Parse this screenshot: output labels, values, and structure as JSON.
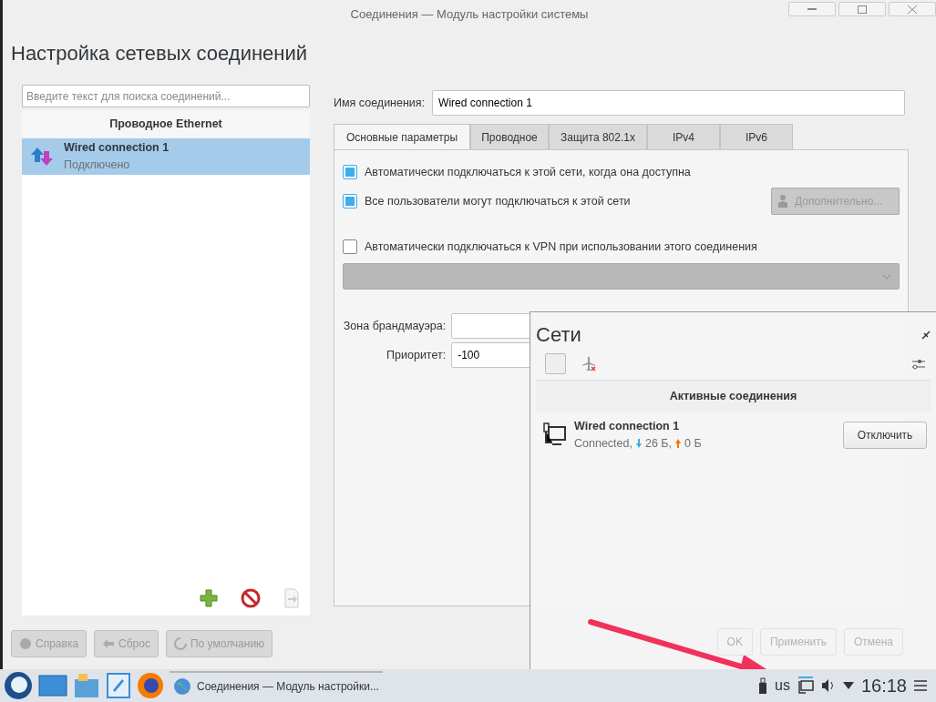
{
  "window": {
    "title": "Соединения — Модуль настройки системы",
    "heading": "Настройка сетевых соединений"
  },
  "connections": {
    "search_placeholder": "Введите текст для поиска соединений...",
    "group": "Проводное Ethernet",
    "items": [
      {
        "name": "Wired connection 1",
        "status": "Подключено",
        "selected": true
      }
    ]
  },
  "editor": {
    "name_label": "Имя соединения:",
    "name_value": "Wired connection 1",
    "tabs": [
      {
        "label": "Основные параметры",
        "selected": true
      },
      {
        "label": "Проводное",
        "selected": false
      },
      {
        "label": "Защита 802.1x",
        "selected": false
      },
      {
        "label": "IPv4",
        "selected": false
      },
      {
        "label": "IPv6",
        "selected": false
      }
    ],
    "options": [
      {
        "label": "Автоматически подключаться к этой сети, когда она доступна",
        "checked": true
      },
      {
        "label": "Все пользователи могут подключаться к этой сети",
        "checked": true
      },
      {
        "label": "Автоматически подключаться к VPN при использовании этого соединения",
        "checked": false
      }
    ],
    "advanced_button": {
      "label": "Дополнительно...",
      "disabled": true
    },
    "vpn_combo": {
      "disabled": true
    },
    "firewall_label": "Зона брандмауэра:",
    "priority_label": "Приоритет:",
    "priority_value": "-100"
  },
  "footer_buttons": [
    {
      "label": "Справка",
      "disabled": true
    },
    {
      "label": "Сброс",
      "disabled": true
    },
    {
      "label": "По умолчанию",
      "disabled": true
    }
  ],
  "dialog_buttons": [
    {
      "label": "OK"
    },
    {
      "label": "Применить"
    },
    {
      "label": "Отмена"
    }
  ],
  "networks_popup": {
    "title": "Сети",
    "section": "Активные соединения",
    "connections": [
      {
        "name": "Wired connection 1",
        "status": "Connected,",
        "download": "26 Б,",
        "upload": "0 Б",
        "button": "Отключить"
      }
    ]
  },
  "taskbar": {
    "task": "Соединения — Модуль настройки...",
    "keyboard_layout": "us",
    "clock": "16:18"
  }
}
